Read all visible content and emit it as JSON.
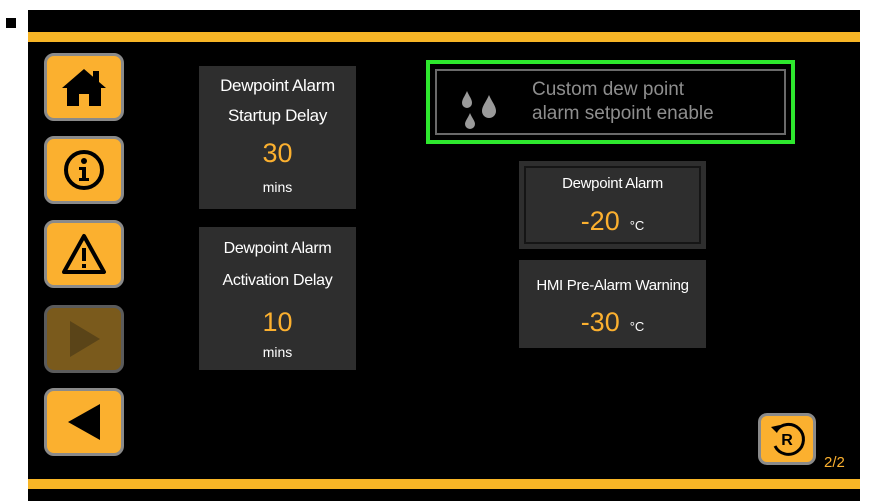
{
  "nav": {
    "home": {
      "icon": "home-icon"
    },
    "info": {
      "icon": "info-icon"
    },
    "alarm": {
      "icon": "warning-icon"
    },
    "forward": {
      "icon": "play-icon",
      "disabled": true
    },
    "back": {
      "icon": "back-arrow-icon"
    }
  },
  "startup_delay": {
    "title_line1": "Dewpoint Alarm",
    "title_line2": "Startup Delay",
    "value": "30",
    "unit": "mins"
  },
  "activation_delay": {
    "title_line1": "Dewpoint Alarm",
    "title_line2": "Activation Delay",
    "value": "10",
    "unit": "mins"
  },
  "custom_setpoint": {
    "line1": "Custom dew point",
    "line2": "alarm setpoint enable",
    "icon": "water-drops-icon",
    "highlight_color": "#2ee82e"
  },
  "dewpoint_alarm": {
    "title": "Dewpoint Alarm",
    "value": "-20",
    "unit": "°C"
  },
  "hmi_pre_alarm": {
    "title": "HMI Pre-Alarm Warning",
    "value": "-30",
    "unit": "°C"
  },
  "reset": {
    "icon": "reset-icon",
    "label": "R"
  },
  "page_indicator": "2/2",
  "colors": {
    "accent": "#fbb02f",
    "background": "#000000",
    "panel": "#2e2e2e",
    "highlight": "#2ee82e"
  }
}
